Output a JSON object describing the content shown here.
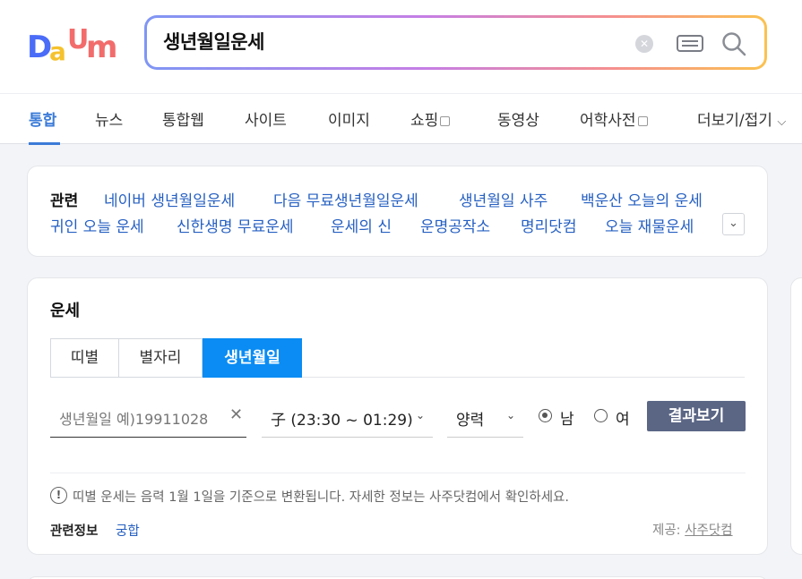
{
  "logo": {
    "letters": [
      "D",
      "a",
      "U",
      "m"
    ],
    "colors": [
      "#4a6cf7",
      "#f5c22e",
      "#f26c6c",
      "#34b9f0",
      "#f26c6c"
    ]
  },
  "search": {
    "query": "생년월일운세",
    "clear_icon": "close-icon",
    "keyboard_icon": "keyboard-icon",
    "search_icon": "search-icon"
  },
  "tabs": [
    {
      "label": "통합",
      "active": true
    },
    {
      "label": "뉴스"
    },
    {
      "label": "통합웹"
    },
    {
      "label": "사이트"
    },
    {
      "label": "이미지"
    },
    {
      "label": "쇼핑",
      "external": true
    },
    {
      "label": "동영상"
    },
    {
      "label": "어학사전",
      "external": true
    },
    {
      "label": "더보기/접기"
    }
  ],
  "related": {
    "label": "관련",
    "links": [
      "네이버 생년월일운세",
      "다음 무료생년월일운세",
      "생년월일 사주",
      "백운산 오늘의 운세",
      "귀인 오늘 운세",
      "신한생명 무료운세",
      "운세의 신",
      "운명공작소",
      "명리닷컴",
      "오늘 재물운세"
    ]
  },
  "fortune": {
    "title": "운세",
    "tabs": [
      {
        "label": "띠별"
      },
      {
        "label": "별자리"
      },
      {
        "label": "생년월일",
        "active": true
      }
    ],
    "birth_placeholder": "생년월일 예)19911028",
    "time_select": "子 (23:30 ~ 01:29)",
    "calendar_select": "양력",
    "gender": [
      {
        "label": "남",
        "checked": true
      },
      {
        "label": "여",
        "checked": false
      }
    ],
    "result_button": "결과보기",
    "notice": "띠별 운세는 음력 1월 1일을 기준으로 변환됩니다. 자세한 정보는 사주닷컴에서 확인하세요.",
    "info_label": "관련정보",
    "info_link": "궁합",
    "provider_label": "제공:",
    "provider_name": "사주닷컴"
  },
  "colors": {
    "accent": "#3b7bd8",
    "link": "#2660c2",
    "active_tab": "#0a8cf4",
    "button": "#5b6685"
  }
}
